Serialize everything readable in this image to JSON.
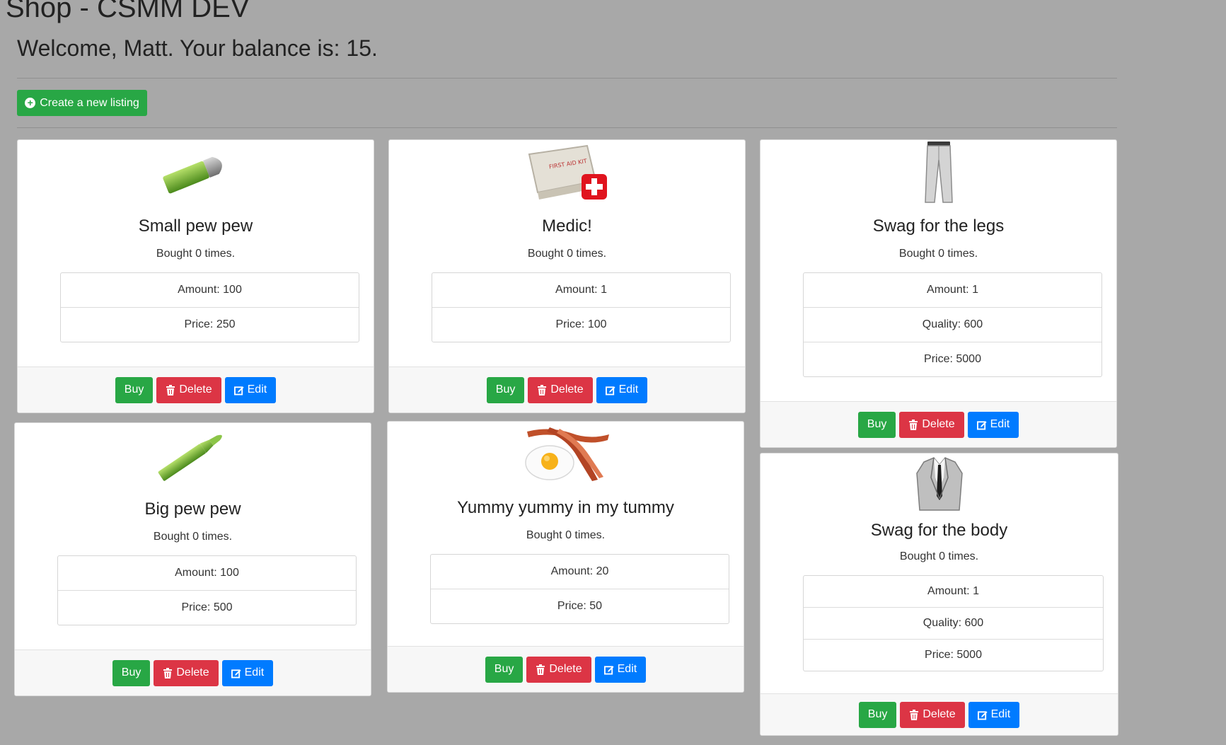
{
  "page": {
    "title": "Shop - CSMM DEV",
    "welcome": "Welcome, Matt. Your balance is: 15."
  },
  "toolbar": {
    "create_label": "Create a new listing"
  },
  "buttons": {
    "buy": "Buy",
    "delete": "Delete",
    "edit": "Edit"
  },
  "listings": [
    {
      "name": "Small pew pew",
      "bought": "Bought 0 times.",
      "image": "bullet-small-icon",
      "details": [
        "Amount: 100",
        "Price: 250"
      ]
    },
    {
      "name": "Medic!",
      "bought": "Bought 0 times.",
      "image": "first-aid-kit-icon",
      "details": [
        "Amount: 1",
        "Price: 100"
      ]
    },
    {
      "name": "Swag for the legs",
      "bought": "Bought 0 times.",
      "image": "pants-icon",
      "details": [
        "Amount: 1",
        "Quality: 600",
        "Price: 5000"
      ]
    },
    {
      "name": "Big pew pew",
      "bought": "Bought 0 times.",
      "image": "rifle-bullet-icon",
      "details": [
        "Amount: 100",
        "Price: 500"
      ]
    },
    {
      "name": "Yummy yummy in my tummy",
      "bought": "Bought 0 times.",
      "image": "bacon-and-egg-icon",
      "details": [
        "Amount: 20",
        "Price: 50"
      ]
    },
    {
      "name": "Swag for the body",
      "bought": "Bought 0 times.",
      "image": "suit-jacket-icon",
      "details": [
        "Amount: 1",
        "Quality: 600",
        "Price: 5000"
      ]
    }
  ]
}
